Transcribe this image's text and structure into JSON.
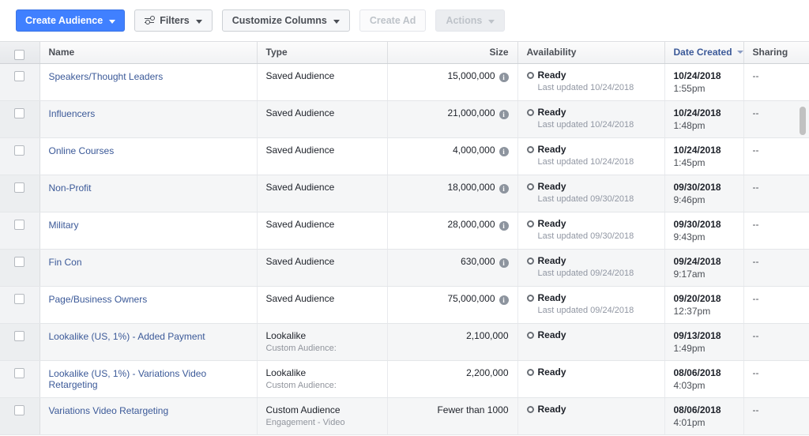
{
  "toolbar": {
    "create_audience": "Create Audience",
    "filters": "Filters",
    "customize_columns": "Customize Columns",
    "create_ad": "Create Ad",
    "actions": "Actions"
  },
  "colors": {
    "primary": "#4080ff",
    "link": "#3b5998",
    "text": "#1d2129",
    "muted": "#90949c",
    "header_bg": "#f1f2f4",
    "row_alt": "#f5f6f7"
  },
  "table": {
    "columns": [
      {
        "key": "check",
        "label": "",
        "align": "left"
      },
      {
        "key": "name",
        "label": "Name",
        "align": "left"
      },
      {
        "key": "type",
        "label": "Type",
        "align": "left"
      },
      {
        "key": "size",
        "label": "Size",
        "align": "right"
      },
      {
        "key": "avail",
        "label": "Availability",
        "align": "left"
      },
      {
        "key": "date",
        "label": "Date Created",
        "align": "left",
        "sorted": true,
        "sort_dir": "desc"
      },
      {
        "key": "share",
        "label": "Sharing",
        "align": "left"
      }
    ],
    "rows": [
      {
        "name": "Speakers/Thought Leaders",
        "type": "Saved Audience",
        "type_sub": "",
        "size": "15,000,000",
        "size_info": true,
        "availability": "Ready",
        "last_updated": "Last updated 10/24/2018",
        "date": "10/24/2018",
        "time": "1:55pm",
        "sharing": "--"
      },
      {
        "name": "Influencers",
        "type": "Saved Audience",
        "type_sub": "",
        "size": "21,000,000",
        "size_info": true,
        "availability": "Ready",
        "last_updated": "Last updated 10/24/2018",
        "date": "10/24/2018",
        "time": "1:48pm",
        "sharing": "--"
      },
      {
        "name": "Online Courses",
        "type": "Saved Audience",
        "type_sub": "",
        "size": "4,000,000",
        "size_info": true,
        "availability": "Ready",
        "last_updated": "Last updated 10/24/2018",
        "date": "10/24/2018",
        "time": "1:45pm",
        "sharing": "--"
      },
      {
        "name": "Non-Profit",
        "type": "Saved Audience",
        "type_sub": "",
        "size": "18,000,000",
        "size_info": true,
        "availability": "Ready",
        "last_updated": "Last updated 09/30/2018",
        "date": "09/30/2018",
        "time": "9:46pm",
        "sharing": "--"
      },
      {
        "name": "Military",
        "type": "Saved Audience",
        "type_sub": "",
        "size": "28,000,000",
        "size_info": true,
        "availability": "Ready",
        "last_updated": "Last updated 09/30/2018",
        "date": "09/30/2018",
        "time": "9:43pm",
        "sharing": "--"
      },
      {
        "name": "Fin Con",
        "type": "Saved Audience",
        "type_sub": "",
        "size": "630,000",
        "size_info": true,
        "availability": "Ready",
        "last_updated": "Last updated 09/24/2018",
        "date": "09/24/2018",
        "time": "9:17am",
        "sharing": "--"
      },
      {
        "name": "Page/Business Owners",
        "type": "Saved Audience",
        "type_sub": "",
        "size": "75,000,000",
        "size_info": true,
        "availability": "Ready",
        "last_updated": "Last updated 09/24/2018",
        "date": "09/20/2018",
        "time": "12:37pm",
        "sharing": "--"
      },
      {
        "name": "Lookalike (US, 1%) - Added Payment",
        "type": "Lookalike",
        "type_sub": "Custom Audience:",
        "size": "2,100,000",
        "size_info": false,
        "availability": "Ready",
        "last_updated": "",
        "date": "09/13/2018",
        "time": "1:49pm",
        "sharing": "--"
      },
      {
        "name": "Lookalike (US, 1%) - Variations Video Retargeting",
        "type": "Lookalike",
        "type_sub": "Custom Audience:",
        "size": "2,200,000",
        "size_info": false,
        "availability": "Ready",
        "last_updated": "",
        "date": "08/06/2018",
        "time": "4:03pm",
        "sharing": "--"
      },
      {
        "name": "Variations Video Retargeting",
        "type": "Custom Audience",
        "type_sub": "Engagement - Video",
        "size": "Fewer than 1000",
        "size_info": false,
        "availability": "Ready",
        "last_updated": "",
        "date": "08/06/2018",
        "time": "4:01pm",
        "sharing": "--"
      }
    ]
  }
}
